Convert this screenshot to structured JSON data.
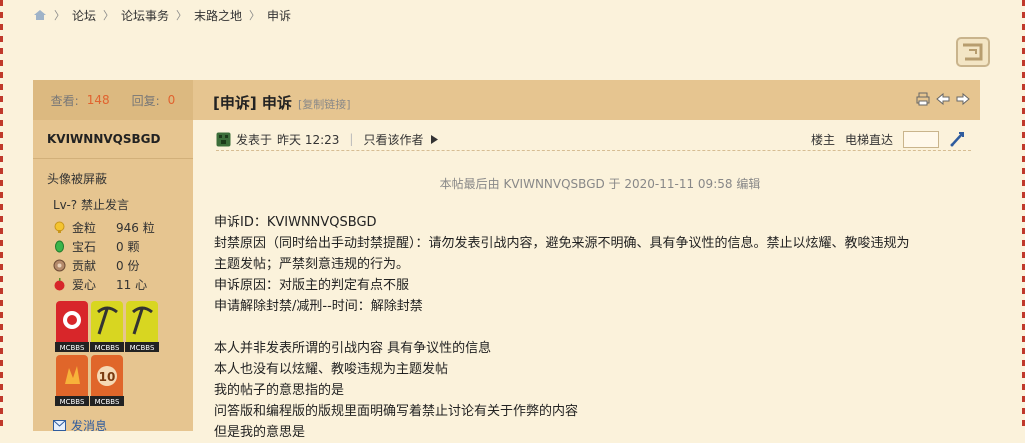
{
  "breadcrumb": [
    "论坛",
    "论坛事务",
    "末路之地",
    "申诉"
  ],
  "user": {
    "views_label": "查看:",
    "views": "148",
    "replies_label": "回复:",
    "replies": "0",
    "name": "KVIWNNVQSBGD",
    "avatar_note": "头像被屏蔽",
    "level": "Lv-? 禁止发言",
    "stats": [
      {
        "icon": "gold-coin-icon",
        "label": "金粒",
        "value": "946 粒"
      },
      {
        "icon": "gem-icon",
        "label": "宝石",
        "value": "0 颗"
      },
      {
        "icon": "contribution-icon",
        "label": "贡献",
        "value": "0 份"
      },
      {
        "icon": "heart-apple-icon",
        "label": "爱心",
        "value": "11 心"
      }
    ],
    "badge_text": "MCBBS",
    "send_message": "发消息"
  },
  "post": {
    "title": "[申诉] 申诉",
    "copy_link": "[复制链接]",
    "posted_prefix": "发表于",
    "posted_time": "昨天 12:23",
    "author_only": "只看该作者",
    "floor": "楼主",
    "jump_label": "电梯直达",
    "edit_note": "本帖最后由 KVIWNNVQSBGD 于 2020-11-11 09:58 编辑",
    "lines": [
      "申诉ID：KVIWNNVQSBGD",
      "封禁原因（同时给出手动封禁提醒）：请勿发表引战内容，避免来源不明确、具有争议性的信息。禁止以炫耀、教唆违规为",
      "主题发帖；严禁刻意违规的行为。",
      "申诉原因：对版主的判定有点不服",
      "申请解除封禁/减刑--时间：解除封禁",
      "",
      "本人并非发表所谓的引战内容 具有争议性的信息",
      "本人也没有以炫耀、教唆违规为主题发帖",
      "我的帖子的意思指的是",
      "问答版和编程版的版规里面明确写着禁止讨论有关于作弊的内容",
      "但是我的意思是"
    ]
  },
  "colors": {
    "accent": "#e0632f",
    "column": "#e6c590",
    "page": "#fbf2db",
    "link": "#2f5c9e"
  }
}
